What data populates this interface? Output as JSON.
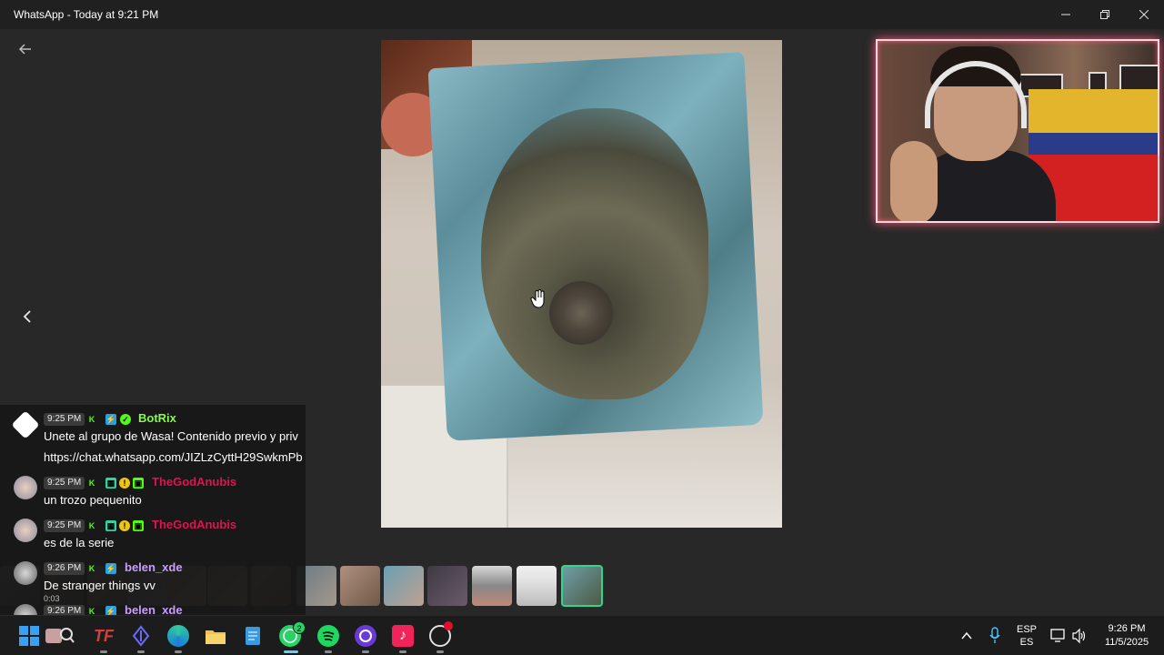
{
  "window": {
    "title": "WhatsApp - Today at 9:21 PM",
    "icons": {
      "minimize": "minimize-icon",
      "maximize": "maximize-icon",
      "close": "close-icon"
    }
  },
  "viewer": {
    "back_icon": "arrow-left-icon",
    "prev_icon": "chevron-left-icon",
    "cursor_icon": "hand-cursor-icon"
  },
  "chat": {
    "messages": [
      {
        "time": "9:25 PM",
        "user": "BotRix",
        "user_color": "#7fff3f",
        "text_lines": [
          "Unete al grupo de Wasa! Contenido previo y priv",
          "https://chat.whatsapp.com/JIZLzCyttH29SwkmPb"
        ]
      },
      {
        "time": "9:25 PM",
        "user": "TheGodAnubis",
        "user_color": "#e0134f",
        "text_lines": [
          "un trozo pequenito"
        ]
      },
      {
        "time": "9:25 PM",
        "user": "TheGodAnubis",
        "user_color": "#e0134f",
        "text_lines": [
          "es de la serie"
        ]
      },
      {
        "time": "9:26 PM",
        "user": "belen_xde",
        "user_color": "#c99cff",
        "text_lines": [
          "De stranger things vv"
        ]
      },
      {
        "time": "9:26 PM",
        "user": "belen_xde",
        "user_color": "#c99cff",
        "text_lines": []
      }
    ],
    "thumb_overlay_time": "0:03"
  },
  "taskbar": {
    "apps": [
      "windows-start-icon",
      "search-icon",
      "tf-app-icon",
      "crypto-app-icon",
      "edge-browser-icon",
      "file-explorer-icon",
      "notepad-icon",
      "whatsapp-icon",
      "spotify-icon",
      "app-circle-icon",
      "tiktok-icon",
      "obs-icon"
    ],
    "whatsapp_badge": "2",
    "lang_top": "ESP",
    "lang_bottom": "ES",
    "time": "9:26 PM",
    "date": "11/5/2025"
  }
}
